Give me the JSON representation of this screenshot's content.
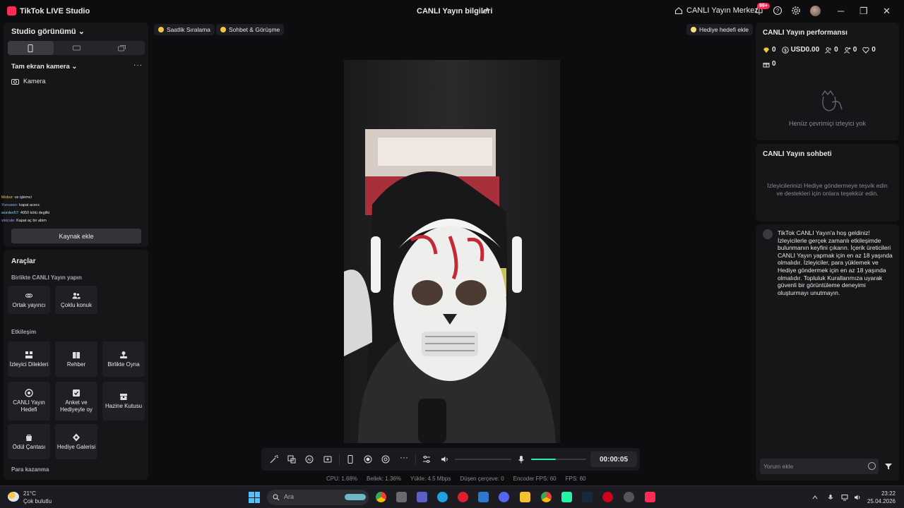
{
  "titlebar": {
    "app_name": "TikTok LIVE Studio",
    "live_info": "CANLI Yayın bilgileri",
    "live_center": "CANLI Yayın Merkezi",
    "notifications_badge": "99+"
  },
  "left": {
    "studio_view": "Studio görünümü",
    "camera_section": "Tam ekran kamera",
    "camera_item": "Kamera",
    "chat_overlay": [
      {
        "user": "Mobur:",
        "text": "ve işlemci"
      },
      {
        "user": "Yunuswz:",
        "text": "kapat acecc"
      },
      {
        "user": "wordex57:",
        "text": "4050 kötü degilki"
      },
      {
        "user": "visicule:",
        "text": "Kapat aç bir abim"
      }
    ],
    "add_source": "Kaynak ekle"
  },
  "tools": {
    "title": "Araçlar",
    "sections": [
      {
        "label": "Birlikte CANLI Yayın yapın",
        "items": [
          "Ortak yayıncı",
          "Çoklu konuk"
        ]
      },
      {
        "label": "Etkileşim",
        "items": [
          "İzleyici Dilekleri",
          "Rehber",
          "Birlikte Oyna",
          "CANLI Yayın Hedefi",
          "Anket ve Hediyeyle oy",
          "Hazine Kutusu",
          "Ödül Çantası",
          "Hediye Galerisi"
        ]
      },
      {
        "label": "Para kazanma",
        "items": []
      }
    ]
  },
  "stage": {
    "pill_hourly": "Saatlik Sıralama",
    "pill_chat": "Sohbet & Görüşme",
    "pill_gift_goal": "Hediye hedefi ekle",
    "timer": "00:00:05",
    "mic_level": 0.45
  },
  "stats": [
    {
      "label": "CPU:",
      "value": "1.68%"
    },
    {
      "label": "Bellek:",
      "value": "1.36%"
    },
    {
      "label": "Yükle:",
      "value": "4.5 Mbps"
    },
    {
      "label": "Düşen çerçeve:",
      "value": "0"
    },
    {
      "label": "Encoder FPS:",
      "value": "60"
    },
    {
      "label": "FPS:",
      "value": "60"
    }
  ],
  "right": {
    "perf_title": "CANLI Yayın performansı",
    "metrics": {
      "diamonds": "0",
      "usd": "USD0.00",
      "viewers": "0",
      "followers": "0",
      "likes": "0",
      "gifts": "0"
    },
    "no_viewers": "Henüz çevrimiçi izleyici yok",
    "chat_title": "CANLI Yayın sohbeti",
    "chat_hint": "İzleyicilerinizi Hediye göndermeye teşvik edin ve destekleri için onlara teşekkür edin.",
    "welcome": "TikTok CANLI Yayın'a hoş geldiniz! İzleyicilerle gerçek zamanlı etkileşimde bulunmanın keyfini çıkarın. İçerik üreticileri CANLI Yayın yapmak için en az 18 yaşında olmalıdır. İzleyiciler, para yüklemek ve Hediye göndermek için en az 18 yaşında olmalıdır. Topluluk Kurallarımıza uyarak güvenli bir görüntüleme deneyimi oluşturmayı unutmayın.",
    "comment_placeholder": "Yorum ekle"
  },
  "taskbar": {
    "temp": "21°C",
    "weather": "Çok bulutlu",
    "search": "Ara",
    "time": "23:22",
    "date": "25.04.2026"
  }
}
